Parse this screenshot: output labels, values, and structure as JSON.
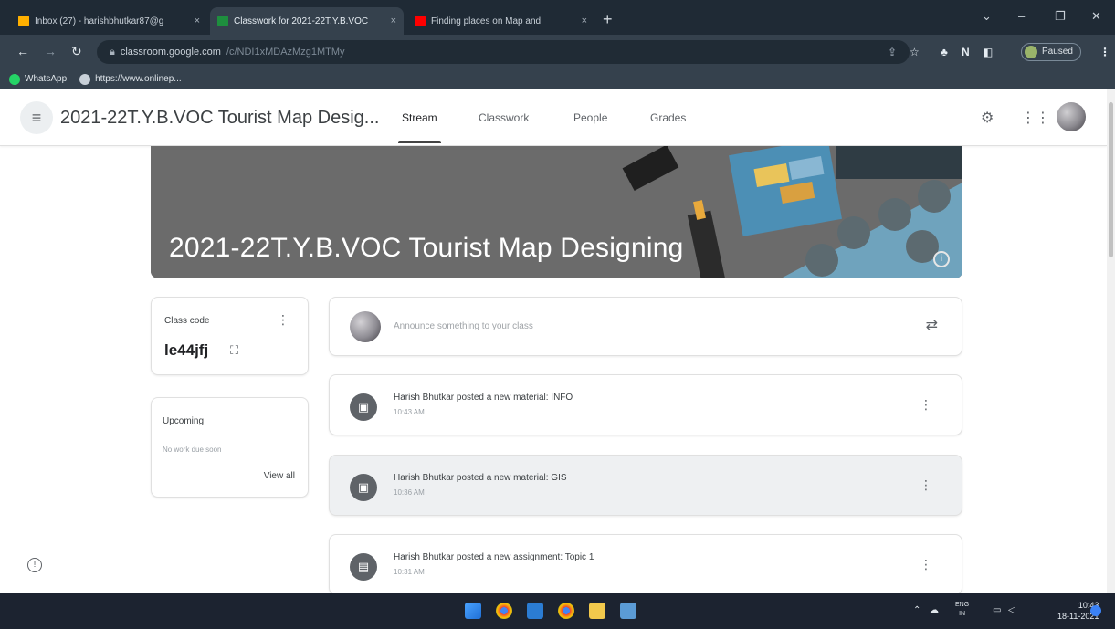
{
  "browser": {
    "tabs": [
      {
        "title": "Inbox (27) - harishbhutkar87@g",
        "active": false,
        "favicon_color": "#ffb000"
      },
      {
        "title": "Classwork for 2021-22T.Y.B.VOC",
        "active": true,
        "favicon_color": "#1e8e3e"
      },
      {
        "title": "Finding places on Map and",
        "active": false,
        "favicon_color": "#ff0000"
      }
    ],
    "url_domain": "classroom.google.com",
    "url_path": "/c/NDI1xMDAzMzg1MTMy",
    "profile_label": "Paused",
    "bookmarks": [
      {
        "label": "WhatsApp",
        "icon": "whatsapp-icon",
        "color": "#25d366"
      },
      {
        "label": "https://www.onlinep...",
        "icon": "globe-icon",
        "color": "#c9d1d9"
      }
    ]
  },
  "header": {
    "class_title": "2021-22T.Y.B.VOC Tourist Map Desig...",
    "nav_tabs": [
      "Stream",
      "Classwork",
      "People",
      "Grades"
    ],
    "active_tab": "Stream"
  },
  "banner": {
    "title": "2021-22T.Y.B.VOC Tourist Map Designing"
  },
  "class_code": {
    "label": "Class code",
    "code": "le44jfj"
  },
  "upcoming": {
    "label": "Upcoming",
    "subtitle": "No work due soon",
    "view_all": "View all"
  },
  "announce": {
    "placeholder": "Announce something to your class"
  },
  "posts": [
    {
      "title": "Harish Bhutkar posted a new material: INFO",
      "time": "10:43 AM",
      "icon": "material-icon"
    },
    {
      "title": "Harish Bhutkar posted a new material: GIS",
      "time": "10:36 AM",
      "icon": "material-icon"
    },
    {
      "title": "Harish Bhutkar posted a new assignment: Topic 1",
      "time": "10:31 AM",
      "icon": "assignment-icon"
    }
  ],
  "taskbar": {
    "time": "10:43",
    "date": "18-11-2021",
    "lang_top": "ENG",
    "lang_bottom": "IN"
  },
  "colors": {
    "chrome_dark": "#1f2a35",
    "chrome_mid": "#35414d",
    "banner_gray": "#6b6b6b",
    "post_icon_gray": "#5f6368"
  }
}
